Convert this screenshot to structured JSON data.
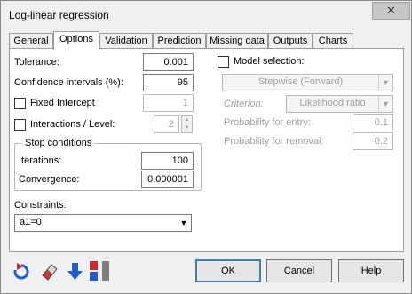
{
  "window": {
    "title": "Log-linear regression",
    "close_glyph": "✕"
  },
  "tabs": [
    {
      "label": "General"
    },
    {
      "label": "Options"
    },
    {
      "label": "Validation"
    },
    {
      "label": "Prediction"
    },
    {
      "label": "Missing data"
    },
    {
      "label": "Outputs"
    },
    {
      "label": "Charts"
    }
  ],
  "options": {
    "tolerance_label": "Tolerance:",
    "tolerance_value": "0.001",
    "conf_label": "Confidence intervals (%):",
    "conf_value": "95",
    "fixed_intercept_label": "Fixed Intercept",
    "fixed_intercept_value": "1",
    "interactions_label": "Interactions / Level:",
    "interactions_value": "2",
    "stop_label": "Stop conditions",
    "iterations_label": "Iterations:",
    "iterations_value": "100",
    "convergence_label": "Convergence:",
    "convergence_value": "0.000001",
    "model_selection_label": "Model selection:",
    "model_selection_method": "Stepwise (Forward)",
    "criterion_label": "Criterion:",
    "criterion_value": "Likelihood ratio",
    "prob_entry_label": "Probability for entry:",
    "prob_entry_value": "0.1",
    "prob_removal_label": "Probability for removal:",
    "prob_removal_value": "0.2",
    "constraints_label": "Constraints:",
    "constraints_value": "a1=0"
  },
  "buttons": {
    "ok": "OK",
    "cancel": "Cancel",
    "help": "Help"
  },
  "icons": [
    "reset-icon",
    "eraser-icon",
    "download-arrow-icon",
    "stack-icon"
  ],
  "colors": {
    "accent": "#3c7fb1",
    "blue": "#1a5fd6",
    "red": "#d9232d"
  }
}
